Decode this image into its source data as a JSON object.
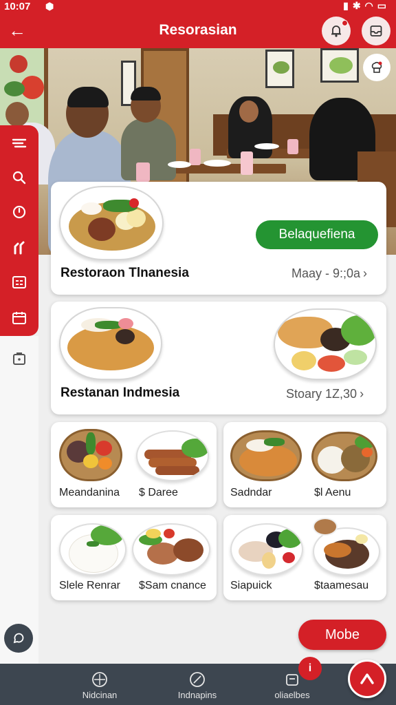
{
  "status_bar": {
    "time": "10:07",
    "icons": [
      "signal-icon",
      "bluetooth-icon",
      "wifi-icon",
      "battery-icon"
    ]
  },
  "header": {
    "title": "Resorasian",
    "back_icon": "arrow-left-icon",
    "notification_icon": "bell-icon",
    "tray_icon": "inbox-icon"
  },
  "colors": {
    "brand_red": "#d42027",
    "accent_green": "#249432",
    "nav_dark": "#3d4650"
  },
  "side_rail": {
    "items": [
      "filter-icon",
      "search-icon",
      "clock-icon",
      "route-icon",
      "menu-card-icon",
      "calendar-icon"
    ],
    "lower_item": "bag-icon",
    "bottom_button": "chat-icon"
  },
  "featured": [
    {
      "title": "Restoraon Tlnanesia",
      "meta": "Maay - 9:;0a",
      "action_label": "Belaquefiena"
    },
    {
      "title": "Restanan Indmesia",
      "meta": "Stoary 1Z,30"
    }
  ],
  "menu_items": [
    {
      "label": "Meandanina"
    },
    {
      "label": "$ Daree"
    },
    {
      "label": "Sadndar"
    },
    {
      "label": "$l Aenu"
    },
    {
      "label": "Slele Renrar"
    },
    {
      "label": "$Sam cnance"
    },
    {
      "label": "Siapuick"
    },
    {
      "label": "$taamesau"
    }
  ],
  "more_button": "Mobe",
  "bottom_nav": {
    "items": [
      {
        "label": "Nidcinan",
        "icon": "compass-icon"
      },
      {
        "label": "Indnapins",
        "icon": "leaf-icon"
      },
      {
        "label": "oliaelbes",
        "icon": "store-icon"
      }
    ],
    "badge": "i",
    "fab_icon": "up-chevron-icon"
  }
}
